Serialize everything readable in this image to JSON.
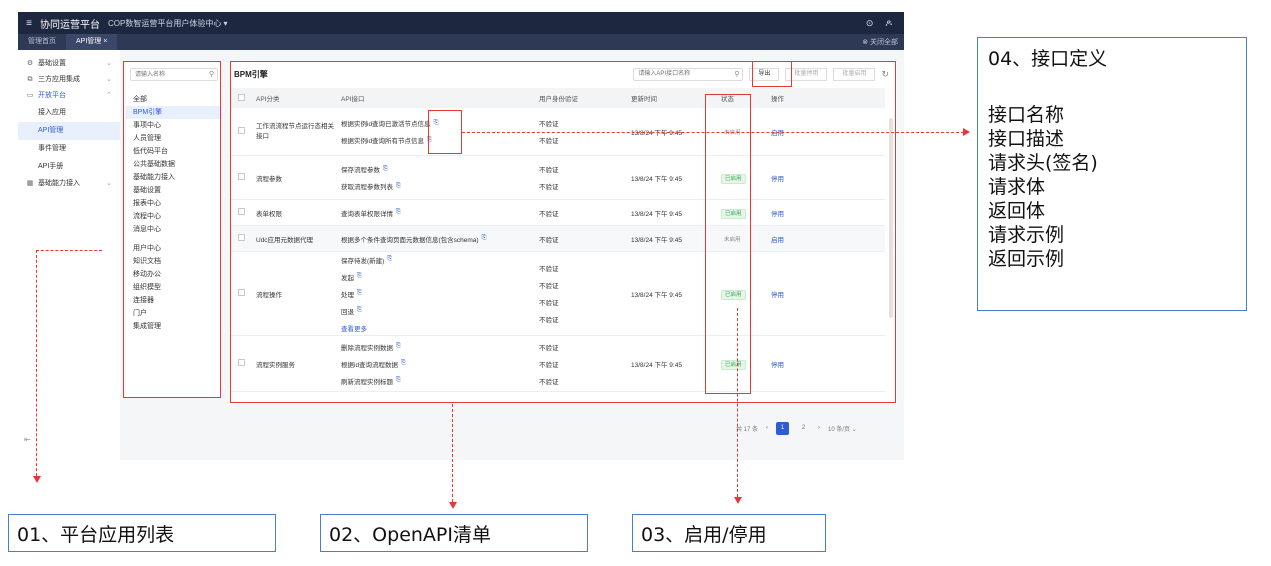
{
  "topbar": {
    "brand": "协同运营平台",
    "tenant": "COP数智运营平台用户体验中心 ▾",
    "menu_icon": "≡",
    "help_icon": "⊙",
    "user_icon": "ዶ"
  },
  "tabbar": {
    "tabs": [
      "管理首页",
      "API管理 ×"
    ],
    "close_all": "⊗ 关闭全部"
  },
  "nav": {
    "groups": [
      {
        "label": "基础设置",
        "icon": "⚙"
      },
      {
        "label": "三方应用集成",
        "icon": "⧉"
      },
      {
        "label": "开放平台",
        "icon": "▭"
      },
      {
        "label": "基础能力接入",
        "icon": "▦"
      }
    ],
    "sub_items": [
      "接入应用",
      "API管理",
      "事件管理",
      "API手册"
    ],
    "collapse": "⇤"
  },
  "catlist": {
    "search_placeholder": "请输入名称",
    "items": [
      "全部",
      "BPM引擎",
      "事项中心",
      "人员管理",
      "低代码平台",
      "公共基础数据",
      "基础能力接入",
      "基础设置",
      "报表中心",
      "流程中心",
      "消息中心",
      "用户中心",
      "知识文档",
      "移动办公",
      "组织模型",
      "连接器",
      "门户",
      "集成管理"
    ]
  },
  "panel": {
    "title": "BPM引擎",
    "search_placeholder": "请输入API接口名称",
    "export_label": "导出",
    "batch_disable_label": "批量停用",
    "batch_enable_label": "批量启用",
    "refresh_icon": "↻"
  },
  "table": {
    "headers": [
      "API分类",
      "API接口",
      "用户身份验证",
      "更新时间",
      "状态",
      "操作"
    ],
    "rows": [
      {
        "category": "工作流流程节点运行态相关接口",
        "apis": [
          "根据实例id查询已激活节点信息",
          "根据实例id查询所有节点信息"
        ],
        "auth": [
          "不验证",
          "不验证"
        ],
        "time": "13/8/24 下午 9:45",
        "status": "未启用",
        "op": "启用"
      },
      {
        "category": "流程参数",
        "apis": [
          "保存流程参数",
          "获取流程参数列表"
        ],
        "auth": [
          "不验证",
          "不验证"
        ],
        "time": "13/8/24 下午 9:45",
        "status": "已启用",
        "op": "停用"
      },
      {
        "category": "表单权限",
        "apis": [
          "查询表单权限详情"
        ],
        "auth": [
          "不验证"
        ],
        "time": "13/8/24 下午 9:45",
        "status": "已启用",
        "op": "停用"
      },
      {
        "category": "Udc应用元数据代理",
        "apis": [
          "根据多个条件查询页面元数据信息(包含schema)"
        ],
        "auth": [
          "不验证"
        ],
        "time": "13/8/24 下午 9:45",
        "status": "未启用",
        "op": "启用"
      },
      {
        "category": "流程操作",
        "apis": [
          "保存待发(新建)",
          "发起",
          "处理",
          "回退"
        ],
        "auth": [
          "不验证",
          "不验证",
          "不验证",
          "不验证"
        ],
        "time": "13/8/24 下午 9:45",
        "status": "已启用",
        "op": "停用",
        "more": "查看更多"
      },
      {
        "category": "流程实例服务",
        "apis": [
          "删除流程实例数据",
          "根据id查询流程数据",
          "刷新流程实例标题"
        ],
        "auth": [
          "不验证",
          "不验证",
          "不验证"
        ],
        "time": "13/8/24 下午 9:45",
        "status": "已启用",
        "op": "停用"
      }
    ]
  },
  "pager": {
    "total": "共 17 条",
    "prev": "‹",
    "pages": [
      "1",
      "2"
    ],
    "next": "›",
    "page_size": "10 条/页 ⌄"
  },
  "callouts": {
    "interface_def": {
      "title": "04、接口定义",
      "lines": [
        "接口名称",
        "接口描述",
        "请求头(签名)",
        "请求体",
        "返回体",
        "请求示例",
        "返回示例"
      ]
    },
    "app_list": "01、平台应用列表",
    "openapi_list": "02、OpenAPI清单",
    "enable_disable": "03、启用/停用"
  },
  "colors": {
    "annotation_red": "#e53935",
    "callout_border": "#4a7ec9",
    "accent_blue": "#2f5bd3",
    "topbar_bg": "#1d2740"
  }
}
